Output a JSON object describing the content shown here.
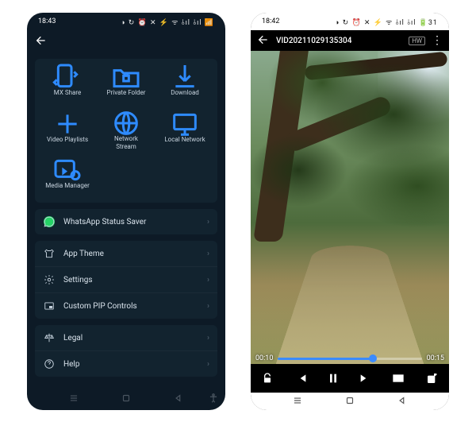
{
  "left": {
    "status_time": "18:43",
    "status_icons": "◑ ↻ ⏰ ✕ ⚡ ᯤ ⫰ıl ⫰ıl 📶",
    "grid": [
      {
        "label": "MX Share",
        "icon": "share-icon"
      },
      {
        "label": "Private Folder",
        "icon": "lock-folder-icon"
      },
      {
        "label": "Download",
        "icon": "download-icon"
      },
      {
        "label": "Video Playlists",
        "icon": "plus-icon"
      },
      {
        "label": "Network\nStream",
        "icon": "globe-icon"
      },
      {
        "label": "Local Network",
        "icon": "monitor-icon"
      },
      {
        "label": "Media Manager",
        "icon": "media-manager-icon"
      }
    ],
    "rows1": [
      {
        "label": "WhatsApp Status Saver",
        "icon": "whatsapp-icon"
      }
    ],
    "rows2": [
      {
        "label": "App Theme",
        "icon": "tshirt-icon"
      },
      {
        "label": "Settings",
        "icon": "gear-icon"
      },
      {
        "label": "Custom PIP Controls",
        "icon": "pip-icon"
      }
    ],
    "rows3": [
      {
        "label": "Legal",
        "icon": "scale-icon"
      },
      {
        "label": "Help",
        "icon": "help-icon"
      }
    ],
    "chevron": "›"
  },
  "right": {
    "status_time": "18:42",
    "status_icons": "◑ ↻ ⏰ ✕ ⚡ ᯤ ⫰ıl ⫰ıl 🔋31",
    "title": "VID20211029135304",
    "hw_label": "HW",
    "time_current": "00:10",
    "time_total": "00:15",
    "progress_pct": 66
  }
}
